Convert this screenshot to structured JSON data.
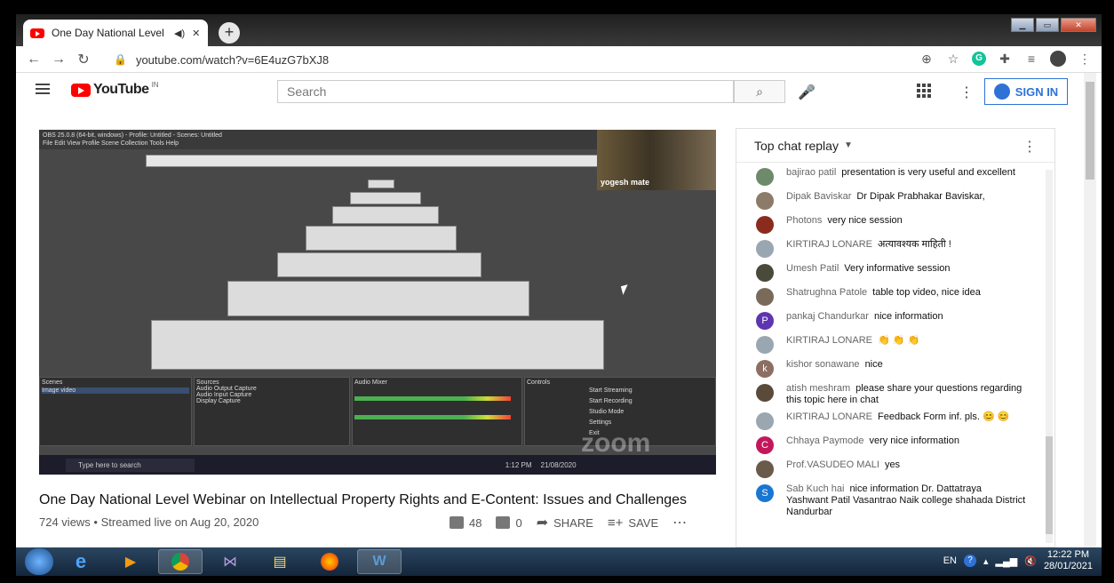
{
  "browser": {
    "tab_title": "One Day National Level Web",
    "url": "youtube.com/watch?v=6E4uzG7bXJ8"
  },
  "youtube": {
    "logo_text": "YouTube",
    "region": "IN",
    "search_placeholder": "Search",
    "sign_in": "SIGN IN"
  },
  "video": {
    "title": "One Day National Level Webinar on Intellectual Property Rights and E-Content: Issues and Challenges",
    "meta": "724 views • Streamed live on Aug 20, 2020",
    "likes": "48",
    "dislikes": "0",
    "share": "SHARE",
    "save": "SAVE",
    "obs_title": "OBS 25.0.8 (64-bit, windows) - Profile: Untitled - Scenes: Untitled",
    "obs_menu": "File  Edit  View  Profile  Scene Collection  Tools  Help",
    "presenter": "yogesh mate",
    "watermark": "zoom",
    "obs_panels": [
      "Scenes",
      "Sources",
      "Audio Mixer",
      "Controls"
    ],
    "obs_scene": "Image video",
    "obs_sources": [
      "Audio Output Capture",
      "Audio Input Capture",
      "Display Capture"
    ],
    "obs_controls": [
      "Start Streaming",
      "Start Recording",
      "Studio Mode",
      "Settings",
      "Exit"
    ],
    "inner_search": "Type here to search",
    "inner_time": "1:12 PM",
    "inner_date": "21/08/2020"
  },
  "chat": {
    "header": "Top chat replay",
    "messages": [
      {
        "author": "bajirao patil",
        "text": "presentation is very useful and excellent",
        "color": "#6d8a6a",
        "initial": ""
      },
      {
        "author": "Dipak Baviskar",
        "text": "Dr Dipak Prabhakar Baviskar,",
        "color": "#8d7b6a",
        "initial": ""
      },
      {
        "author": "Photons",
        "text": "very nice session",
        "color": "#8a2b1e",
        "initial": ""
      },
      {
        "author": "KIRTIRAJ LONARE",
        "text": "अत्यावश्यक माहिती !",
        "color": "#9aa6b0",
        "initial": ""
      },
      {
        "author": "Umesh Patil",
        "text": "Very informative session",
        "color": "#4a4a3a",
        "initial": ""
      },
      {
        "author": "Shatrughna Patole",
        "text": "table top video, nice idea",
        "color": "#7a6a5a",
        "initial": ""
      },
      {
        "author": "pankaj Chandurkar",
        "text": "nice information",
        "color": "#5e35b1",
        "initial": "P"
      },
      {
        "author": "KIRTIRAJ LONARE",
        "text": "👏 👏 👏",
        "color": "#9aa6b0",
        "initial": ""
      },
      {
        "author": "kishor sonawane",
        "text": "nice",
        "color": "#8d6e63",
        "initial": "k"
      },
      {
        "author": "atish meshram",
        "text": "please share your questions regarding this topic here in chat",
        "color": "#5a4a3a",
        "initial": ""
      },
      {
        "author": "KIRTIRAJ LONARE",
        "text": "Feedback Form inf. pls. 😊 😊",
        "color": "#9aa6b0",
        "initial": ""
      },
      {
        "author": "Chhaya Paymode",
        "text": "very nice information",
        "color": "#c2185b",
        "initial": "C"
      },
      {
        "author": "Prof.VASUDEO MALI",
        "text": "yes",
        "color": "#6a5a4a",
        "initial": ""
      },
      {
        "author": "Sab Kuch hai",
        "text": "nice information Dr. Dattatraya Yashwant Patil Vasantrao Naik college shahada District Nandurbar",
        "color": "#1976d2",
        "initial": "S"
      }
    ]
  },
  "taskbar": {
    "lang": "EN",
    "time": "12:22 PM",
    "date": "28/01/2021"
  }
}
